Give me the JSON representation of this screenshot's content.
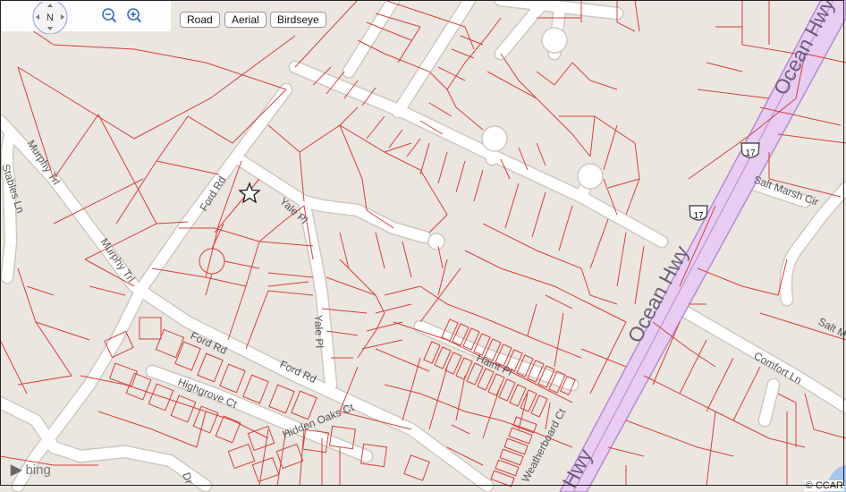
{
  "map_controls": {
    "compass_label": "N",
    "zoom_out_icon": "zoom-out-icon",
    "zoom_in_icon": "zoom-in-icon",
    "views": [
      {
        "label": "Road"
      },
      {
        "label": "Aerial"
      },
      {
        "label": "Birdseye"
      }
    ]
  },
  "streets": {
    "ocean_hwy_upper": "Ocean Hwy",
    "ocean_hwy_lower": "Ocean Hwy",
    "ocean_hwy_bottom": "Hwy",
    "route_shield_1": "17",
    "route_shield_2": "17",
    "murphy_trl_upper": "Murphy Trl",
    "murphy_trl_lower": "Murphy Trl",
    "stables_ln": "Stables Ln",
    "ford_rd_upper": "Ford Rd",
    "ford_rd_mid": "Ford Rd",
    "ford_rd_lower": "Ford Rd",
    "yale_pl_upper": "Yale Pl",
    "yale_pl_lower": "Yale Pl",
    "salt_marsh_cir_upper": "Salt Marsh Cir",
    "salt_marsh_cir_lower": "Salt M",
    "comfort_ln": "Comfort Ln",
    "haint_pl": "Haint Pl",
    "highgrove_ct": "Highgrove Ct",
    "hidden_oaks_ct": "Hidden Oaks Ct",
    "weatherboard_ct": "Weatherboard Ct",
    "partial_label": "Dr"
  },
  "attribution": {
    "provider_logo": "bing",
    "copyright": "© CCAR"
  },
  "colors": {
    "land": "#ebe6e0",
    "parcel_lines": "#d6403b",
    "road_fill": "#ffffff",
    "highway_fill": "#e8ccf2",
    "highway_edge": "#b48ad4",
    "water": "#a6c8ec"
  },
  "marker_icon": "star-outline-icon"
}
